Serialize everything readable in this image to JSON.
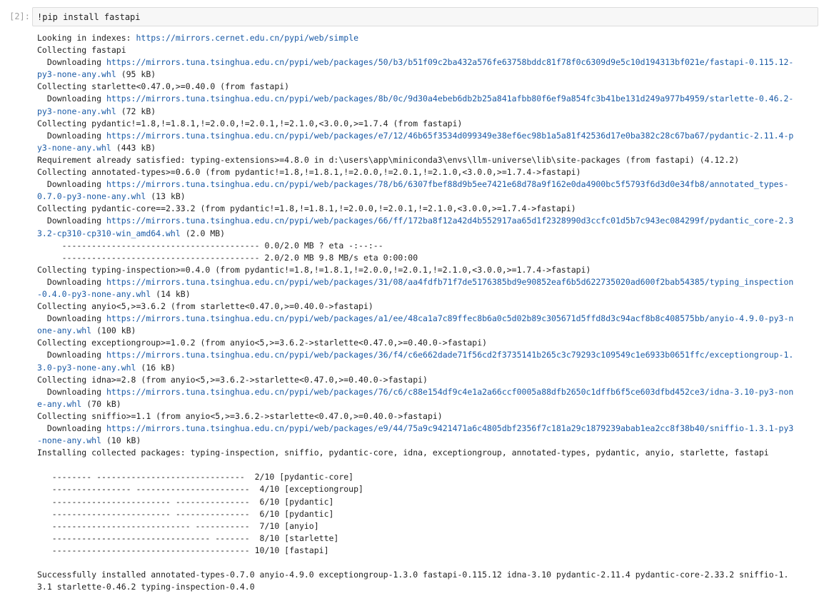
{
  "cell": {
    "prompt": "[2]:",
    "code": "!pip install fastapi"
  },
  "output_lines": [
    {
      "text": "Looking in indexes: ",
      "url": "https://mirrors.cernet.edu.cn/pypi/web/simple",
      "tail": ""
    },
    {
      "text": "Collecting fastapi",
      "url": "",
      "tail": ""
    },
    {
      "text": "  Downloading ",
      "url": "https://mirrors.tuna.tsinghua.edu.cn/pypi/web/packages/50/b3/b51f09c2ba432a576fe63758bddc81f78f0c6309d9e5c10d194313bf021e/fastapi-0.115.12-",
      "tail": ""
    },
    {
      "text": "",
      "url": "py3-none-any.whl",
      "tail": " (95 kB)"
    },
    {
      "text": "Collecting starlette<0.47.0,>=0.40.0 (from fastapi)",
      "url": "",
      "tail": ""
    },
    {
      "text": "  Downloading ",
      "url": "https://mirrors.tuna.tsinghua.edu.cn/pypi/web/packages/8b/0c/9d30a4ebeb6db2b25a841afbb80f6ef9a854fc3b41be131d249a977b4959/starlette-0.46.2-",
      "tail": ""
    },
    {
      "text": "",
      "url": "py3-none-any.whl",
      "tail": " (72 kB)"
    },
    {
      "text": "Collecting pydantic!=1.8,!=1.8.1,!=2.0.0,!=2.0.1,!=2.1.0,<3.0.0,>=1.7.4 (from fastapi)",
      "url": "",
      "tail": ""
    },
    {
      "text": "  Downloading ",
      "url": "https://mirrors.tuna.tsinghua.edu.cn/pypi/web/packages/e7/12/46b65f3534d099349e38ef6ec98b1a5a81f42536d17e0ba382c28c67ba67/pydantic-2.11.4-p",
      "tail": ""
    },
    {
      "text": "",
      "url": "y3-none-any.whl",
      "tail": " (443 kB)"
    },
    {
      "text": "Requirement already satisfied: typing-extensions>=4.8.0 in d:\\users\\app\\miniconda3\\envs\\llm-universe\\lib\\site-packages (from fastapi) (4.12.2)",
      "url": "",
      "tail": ""
    },
    {
      "text": "Collecting annotated-types>=0.6.0 (from pydantic!=1.8,!=1.8.1,!=2.0.0,!=2.0.1,!=2.1.0,<3.0.0,>=1.7.4->fastapi)",
      "url": "",
      "tail": ""
    },
    {
      "text": "  Downloading ",
      "url": "https://mirrors.tuna.tsinghua.edu.cn/pypi/web/packages/78/b6/6307fbef88d9b5ee7421e68d78a9f162e0da4900bc5f5793f6d3d0e34fb8/annotated_types-",
      "tail": ""
    },
    {
      "text": "",
      "url": "0.7.0-py3-none-any.whl",
      "tail": " (13 kB)"
    },
    {
      "text": "Collecting pydantic-core==2.33.2 (from pydantic!=1.8,!=1.8.1,!=2.0.0,!=2.0.1,!=2.1.0,<3.0.0,>=1.7.4->fastapi)",
      "url": "",
      "tail": ""
    },
    {
      "text": "  Downloading ",
      "url": "https://mirrors.tuna.tsinghua.edu.cn/pypi/web/packages/66/ff/172ba8f12a42d4b552917aa65d1f2328990d3ccfc01d5b7c943ec084299f/pydantic_core-2.3",
      "tail": ""
    },
    {
      "text": "",
      "url": "3.2-cp310-cp310-win_amd64.whl",
      "tail": " (2.0 MB)"
    },
    {
      "text": "     ---------------------------------------- 0.0/2.0 MB ? eta -:--:--",
      "url": "",
      "tail": ""
    },
    {
      "text": "     ---------------------------------------- 2.0/2.0 MB 9.8 MB/s eta 0:00:00",
      "url": "",
      "tail": ""
    },
    {
      "text": "Collecting typing-inspection>=0.4.0 (from pydantic!=1.8,!=1.8.1,!=2.0.0,!=2.0.1,!=2.1.0,<3.0.0,>=1.7.4->fastapi)",
      "url": "",
      "tail": ""
    },
    {
      "text": "  Downloading ",
      "url": "https://mirrors.tuna.tsinghua.edu.cn/pypi/web/packages/31/08/aa4fdfb71f7de5176385bd9e90852eaf6b5d622735020ad600f2bab54385/typing_inspection",
      "tail": ""
    },
    {
      "text": "",
      "url": "-0.4.0-py3-none-any.whl",
      "tail": " (14 kB)"
    },
    {
      "text": "Collecting anyio<5,>=3.6.2 (from starlette<0.47.0,>=0.40.0->fastapi)",
      "url": "",
      "tail": ""
    },
    {
      "text": "  Downloading ",
      "url": "https://mirrors.tuna.tsinghua.edu.cn/pypi/web/packages/a1/ee/48ca1a7c89ffec8b6a0c5d02b89c305671d5ffd8d3c94acf8b8c408575bb/anyio-4.9.0-py3-n",
      "tail": ""
    },
    {
      "text": "",
      "url": "one-any.whl",
      "tail": " (100 kB)"
    },
    {
      "text": "Collecting exceptiongroup>=1.0.2 (from anyio<5,>=3.6.2->starlette<0.47.0,>=0.40.0->fastapi)",
      "url": "",
      "tail": ""
    },
    {
      "text": "  Downloading ",
      "url": "https://mirrors.tuna.tsinghua.edu.cn/pypi/web/packages/36/f4/c6e662dade71f56cd2f3735141b265c3c79293c109549c1e6933b0651ffc/exceptiongroup-1.",
      "tail": ""
    },
    {
      "text": "",
      "url": "3.0-py3-none-any.whl",
      "tail": " (16 kB)"
    },
    {
      "text": "Collecting idna>=2.8 (from anyio<5,>=3.6.2->starlette<0.47.0,>=0.40.0->fastapi)",
      "url": "",
      "tail": ""
    },
    {
      "text": "  Downloading ",
      "url": "https://mirrors.tuna.tsinghua.edu.cn/pypi/web/packages/76/c6/c88e154df9c4e1a2a66ccf0005a88dfb2650c1dffb6f5ce603dfbd452ce3/idna-3.10-py3-non",
      "tail": ""
    },
    {
      "text": "",
      "url": "e-any.whl",
      "tail": " (70 kB)"
    },
    {
      "text": "Collecting sniffio>=1.1 (from anyio<5,>=3.6.2->starlette<0.47.0,>=0.40.0->fastapi)",
      "url": "",
      "tail": ""
    },
    {
      "text": "  Downloading ",
      "url": "https://mirrors.tuna.tsinghua.edu.cn/pypi/web/packages/e9/44/75a9c9421471a6c4805dbf2356f7c181a29c1879239abab1ea2cc8f38b40/sniffio-1.3.1-py3",
      "tail": ""
    },
    {
      "text": "",
      "url": "-none-any.whl",
      "tail": " (10 kB)"
    },
    {
      "text": "Installing collected packages: typing-inspection, sniffio, pydantic-core, idna, exceptiongroup, annotated-types, pydantic, anyio, starlette, fastapi",
      "url": "",
      "tail": ""
    },
    {
      "text": "",
      "url": "",
      "tail": ""
    },
    {
      "text": "   -------- ------------------------------  2/10 [pydantic-core]",
      "url": "",
      "tail": ""
    },
    {
      "text": "   ---------------- -----------------------  4/10 [exceptiongroup]",
      "url": "",
      "tail": ""
    },
    {
      "text": "   ------------------------ ---------------  6/10 [pydantic]",
      "url": "",
      "tail": ""
    },
    {
      "text": "   ------------------------ ---------------  6/10 [pydantic]",
      "url": "",
      "tail": ""
    },
    {
      "text": "   ---------------------------- -----------  7/10 [anyio]",
      "url": "",
      "tail": ""
    },
    {
      "text": "   -------------------------------- -------  8/10 [starlette]",
      "url": "",
      "tail": ""
    },
    {
      "text": "   ---------------------------------------- 10/10 [fastapi]",
      "url": "",
      "tail": ""
    },
    {
      "text": "",
      "url": "",
      "tail": ""
    },
    {
      "text": "Successfully installed annotated-types-0.7.0 anyio-4.9.0 exceptiongroup-1.3.0 fastapi-0.115.12 idna-3.10 pydantic-2.11.4 pydantic-core-2.33.2 sniffio-1.",
      "url": "",
      "tail": ""
    },
    {
      "text": "3.1 starlette-0.46.2 typing-inspection-0.4.0",
      "url": "",
      "tail": ""
    }
  ]
}
